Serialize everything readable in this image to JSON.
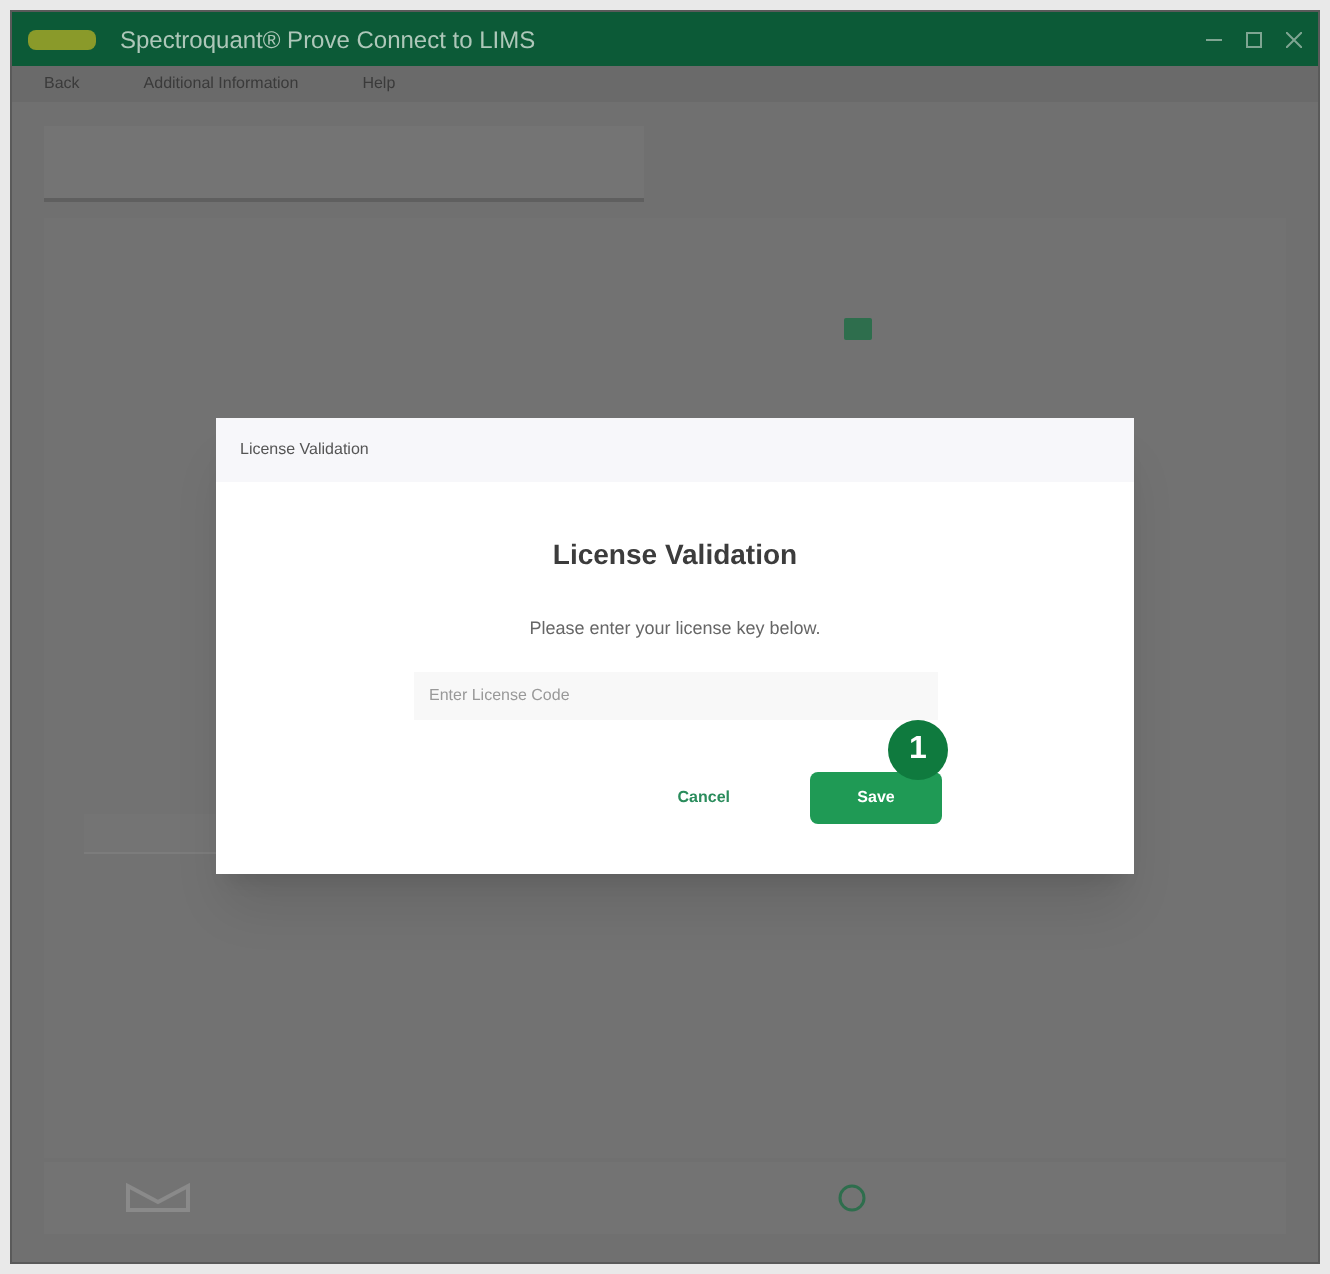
{
  "window": {
    "title": "Spectroquant® Prove Connect to LIMS"
  },
  "menu": [
    "Back",
    "Additional Information",
    "Help"
  ],
  "dialog": {
    "title": "License Validation",
    "heading": "License Validation",
    "message": "Please enter your license key below.",
    "field": {
      "placeholder": "Enter License Code"
    },
    "buttons": [
      {
        "label": "Cancel",
        "kind": "text"
      },
      {
        "label": "Save",
        "kind": "primary"
      }
    ],
    "callout": "1"
  }
}
